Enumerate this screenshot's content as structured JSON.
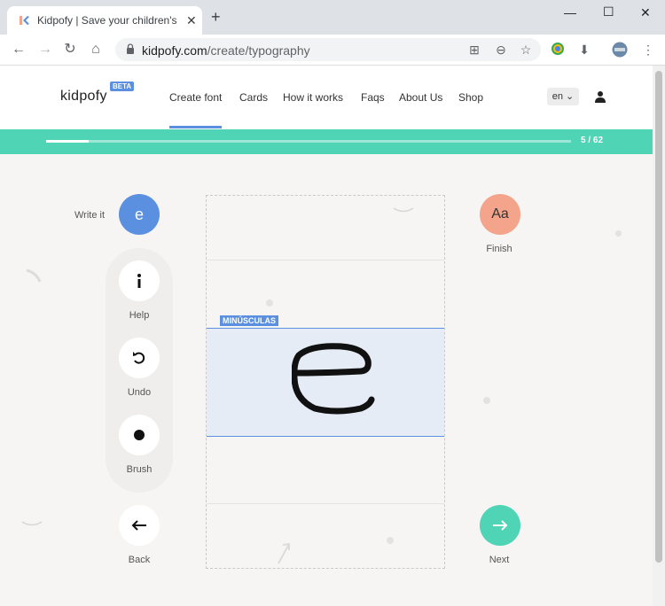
{
  "browser": {
    "tab_title": "Kidpofy | Save your children's d",
    "url_domain": "kidpofy.com",
    "url_path": "/create/typography"
  },
  "header": {
    "logo": "kidpofy",
    "beta": "BETA",
    "nav": [
      "Create font",
      "Cards",
      "How it works",
      "Faqs",
      "About Us",
      "Shop"
    ],
    "active_nav": "Create font",
    "language": "en"
  },
  "progress": {
    "count": "5 / 62",
    "current": 5,
    "total": 62
  },
  "tools": {
    "write_it_label": "Write it",
    "current_letter": "e",
    "help": "Help",
    "undo": "Undo",
    "brush": "Brush",
    "back": "Back"
  },
  "canvas": {
    "band_label": "MINÚSCULAS"
  },
  "right": {
    "finish_label": "Finish",
    "finish_icon_text": "Aa",
    "next_label": "Next"
  },
  "colors": {
    "accent_blue": "#5b8fe0",
    "accent_green": "#4fd4b5",
    "accent_salmon": "#f3a48a"
  }
}
